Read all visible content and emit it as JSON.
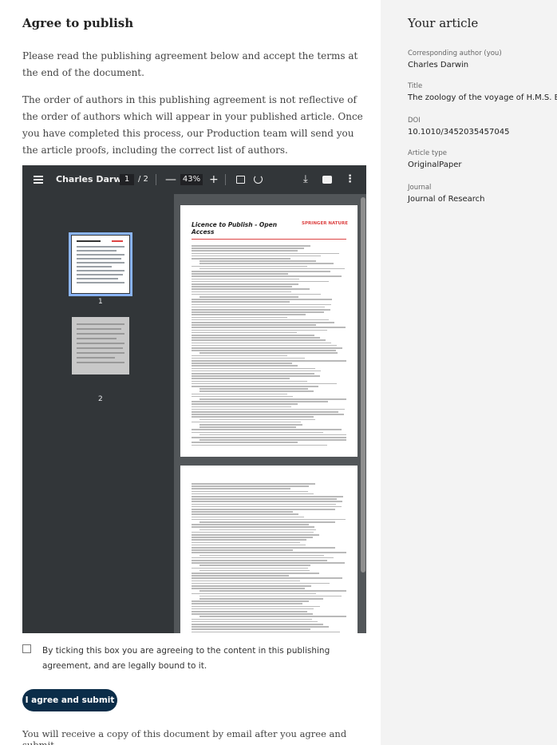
{
  "main": {
    "heading": "Agree to publish",
    "intro": "Please read the publishing agreement below and accept the terms at the end of the document.",
    "authors_note": "The order of authors in this publishing agreement is not reflective of the order of authors which will appear in your published article. Once you have completed this process, our Production team will send you the article proofs, including the correct list of authors.",
    "consent_text": "By ticking this box you are agreeing to the content in this publishing agreement, and are legally bound to it.",
    "submit_label": "I agree and submit",
    "footnote": "You will receive a copy of this document by email after you agree and submit."
  },
  "viewer": {
    "doc_title": "Charles Darwi...",
    "current_page": "1",
    "page_sep": "/ 2",
    "zoom": "43%",
    "zoom_out": "—",
    "zoom_in": "+",
    "thumbnails": [
      {
        "label": "1"
      },
      {
        "label": "2"
      }
    ],
    "document": {
      "title": "Licence to Publish - Open Access",
      "logo": "SPRINGER NATURE"
    },
    "icons": [
      "menu-icon",
      "fit-page-icon",
      "rotate-icon",
      "download-icon",
      "print-icon",
      "more-icon"
    ]
  },
  "sidebar": {
    "heading": "Your article",
    "fields": [
      {
        "label": "Corresponding author (you)",
        "value": "Charles Darwin"
      },
      {
        "label": "Title",
        "value": "The zoology of the voyage of H.M.S. Beagle"
      },
      {
        "label": "DOI",
        "value": "10.1010/3452035457045"
      },
      {
        "label": "Article type",
        "value": "OriginalPaper"
      },
      {
        "label": "Journal",
        "value": "Journal of Research"
      }
    ]
  },
  "colors": {
    "submit_bg": "#0b2d49",
    "viewer_bar": "#323639",
    "viewer_bg": "#525659",
    "accent_red": "#d44444"
  }
}
